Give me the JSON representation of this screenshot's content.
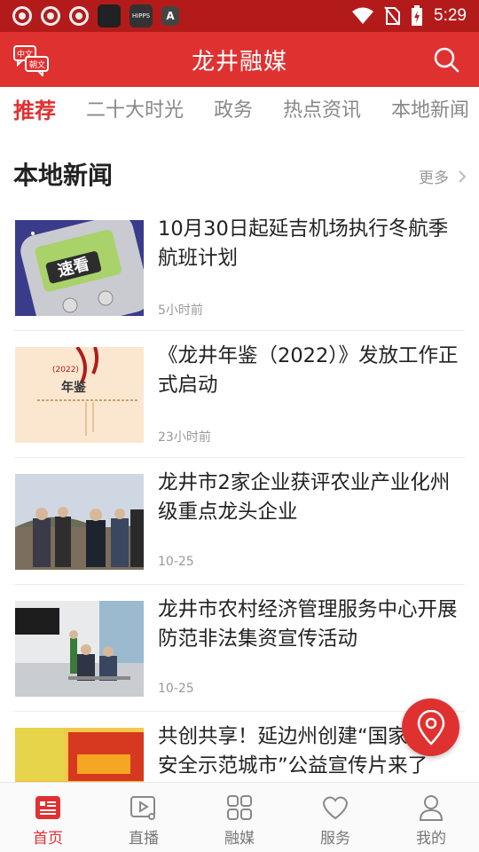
{
  "status_bar": {
    "time": "5:29",
    "notification_icons": [
      "chrome-icon",
      "chrome-icon",
      "chrome-icon",
      "app-square-icon",
      "hipps-icon",
      "a-icon"
    ],
    "hipps_label": "HIPPS",
    "a_label": "A"
  },
  "header": {
    "title": "龙井融媒",
    "lang_top": "中文",
    "lang_bottom": "朝文"
  },
  "tabs": [
    {
      "label": "推荐",
      "active": true
    },
    {
      "label": "二十大时光",
      "active": false
    },
    {
      "label": "政务",
      "active": false
    },
    {
      "label": "热点资讯",
      "active": false
    },
    {
      "label": "本地新闻",
      "active": false
    }
  ],
  "section": {
    "title": "本地新闻",
    "more_label": "更多"
  },
  "news": [
    {
      "title": "10月30日起延吉机场执行冬航季航班计划",
      "time": "5小时前",
      "thumb_text": "速看"
    },
    {
      "title": "《龙井年鉴（2022）》发放工作正式启动",
      "time": "23小时前",
      "thumb_text": "年鉴",
      "thumb_year": "(2022)"
    },
    {
      "title": "龙井市2家企业获评农业产业化州级重点龙头企业",
      "time": "10-25"
    },
    {
      "title": "龙井市农村经济管理服务中心开展防范非法集资宣传活动",
      "time": "10-25"
    },
    {
      "title": "共创共享！延边州创建“国家食品安全示范城市”公益宣传片来了",
      "time": ""
    }
  ],
  "bottom_nav": [
    {
      "label": "首页",
      "icon": "home-news-icon",
      "active": true
    },
    {
      "label": "直播",
      "icon": "live-video-icon",
      "active": false
    },
    {
      "label": "融媒",
      "icon": "grid-icon",
      "active": false
    },
    {
      "label": "服务",
      "icon": "heart-icon",
      "active": false
    },
    {
      "label": "我的",
      "icon": "user-icon",
      "active": false
    }
  ],
  "colors": {
    "brand_red": "#e03131",
    "status_bar": "#b31b1b",
    "muted_text": "#999999"
  }
}
